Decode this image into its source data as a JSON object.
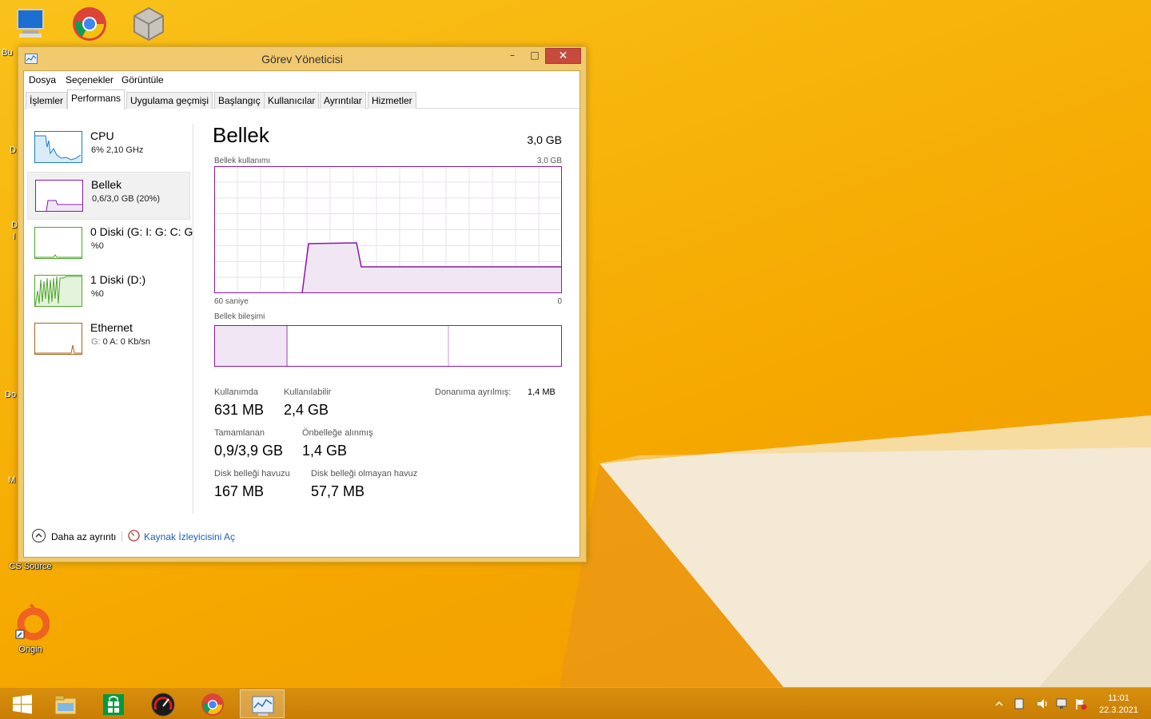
{
  "desktop": {
    "icons": [
      {
        "label": "Bu",
        "icon": "computer-icon"
      },
      {
        "label": "",
        "icon": "chrome-icon"
      },
      {
        "label": "",
        "icon": "cube-app-icon"
      },
      {
        "label": "CS Source",
        "icon": "cs-source-icon"
      },
      {
        "label": "Origin",
        "icon": "origin-icon"
      }
    ],
    "side_labels": [
      "D",
      "D",
      "I",
      "Do",
      "M"
    ]
  },
  "window": {
    "title": "Görev Yöneticisi",
    "controls": {
      "minimize": "–",
      "maximize": "□",
      "close": "✕"
    }
  },
  "menu": [
    "Dosya",
    "Seçenekler",
    "Görüntüle"
  ],
  "tabs": [
    {
      "label": "İşlemler",
      "active": false
    },
    {
      "label": "Performans",
      "active": true
    },
    {
      "label": "Uygulama geçmişi",
      "active": false
    },
    {
      "label": "Başlangıç",
      "active": false
    },
    {
      "label": "Kullanıcılar",
      "active": false
    },
    {
      "label": "Ayrıntılar",
      "active": false
    },
    {
      "label": "Hizmetler",
      "active": false
    }
  ],
  "perf_items": [
    {
      "name": "CPU",
      "sub": "6% 2,10 GHz",
      "color": "#1a7fbf",
      "selected": false
    },
    {
      "name": "Bellek",
      "sub": "0,6/3,0 GB (20%)",
      "color": "#8b18a8",
      "selected": true
    },
    {
      "name": "0 Diski (G: I: G: C: G",
      "sub": "%0",
      "color": "#4da628",
      "selected": false
    },
    {
      "name": "1 Diski (D:)",
      "sub": "%0",
      "color": "#4da628",
      "selected": false
    },
    {
      "name": "Ethernet",
      "sub_prefix": "G: ",
      "sub": "0 A: 0 Kb/sn",
      "color": "#a7651b",
      "selected": false
    }
  ],
  "memory": {
    "title": "Bellek",
    "total": "3,0 GB",
    "usage_label": "Bellek kullanımı",
    "usage_max": "3,0 GB",
    "time_left": "60 saniye",
    "time_right": "0",
    "composition_label": "Bellek bileşimi",
    "accent_color": "#8b18a8",
    "stats": {
      "in_use_label": "Kullanımda",
      "in_use": "631 MB",
      "available_label": "Kullanılabilir",
      "available": "2,4 GB",
      "reserved_label": "Donanıma ayrılmış:",
      "reserved": "1,4 MB",
      "committed_label": "Tamamlanan",
      "committed": "0,9/3,9 GB",
      "cached_label": "Önbelleğe alınmış",
      "cached": "1,4 GB",
      "paged_label": "Disk belleği havuzu",
      "paged": "167 MB",
      "nonpaged_label": "Disk belleği olmayan havuz",
      "nonpaged": "57,7 MB"
    }
  },
  "footer": {
    "less_details": "Daha az ayrıntı",
    "open_resmon": "Kaynak İzleyicisini Aç"
  },
  "taskbar": {
    "apps": [
      "windows-start-icon",
      "file-explorer-icon",
      "store-icon",
      "speedometer-icon",
      "chrome-icon",
      "task-manager-icon"
    ],
    "clock_time": "11:01",
    "clock_date": "22.3.2021"
  }
}
